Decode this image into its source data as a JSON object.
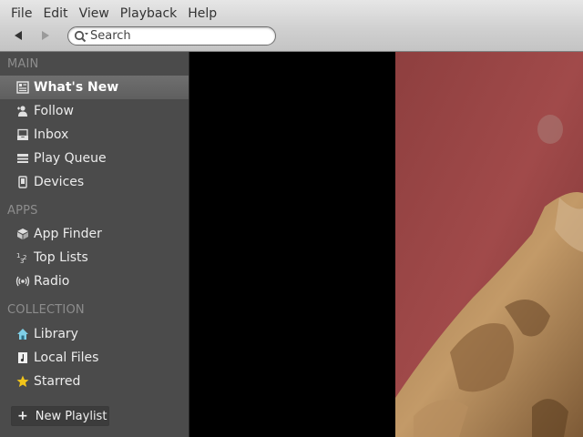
{
  "menu": {
    "file": "File",
    "edit": "Edit",
    "view": "View",
    "playback": "Playback",
    "help": "Help"
  },
  "search": {
    "placeholder": "Search"
  },
  "sidebar": {
    "main_header": "MAIN",
    "main_items": [
      {
        "label": "What's New",
        "icon": "news-icon",
        "selected": true
      },
      {
        "label": "Follow",
        "icon": "follow-icon"
      },
      {
        "label": "Inbox",
        "icon": "inbox-icon"
      },
      {
        "label": "Play Queue",
        "icon": "queue-icon"
      },
      {
        "label": "Devices",
        "icon": "devices-icon"
      }
    ],
    "apps_header": "APPS",
    "apps_items": [
      {
        "label": "App Finder",
        "icon": "app-finder-icon"
      },
      {
        "label": "Top Lists",
        "icon": "top-lists-icon"
      },
      {
        "label": "Radio",
        "icon": "radio-icon"
      }
    ],
    "collection_header": "COLLECTION",
    "collection_items": [
      {
        "label": "Library",
        "icon": "library-icon"
      },
      {
        "label": "Local Files",
        "icon": "local-files-icon"
      },
      {
        "label": "Starred",
        "icon": "star-icon"
      }
    ],
    "new_playlist_label": "New Playlist"
  },
  "colors": {
    "sidebar_bg": "#4b4b4b",
    "selected_bg": "#666666",
    "topbar_bg": "#d4d4d4",
    "star": "#f2c51a",
    "library": "#7fd0e8"
  }
}
